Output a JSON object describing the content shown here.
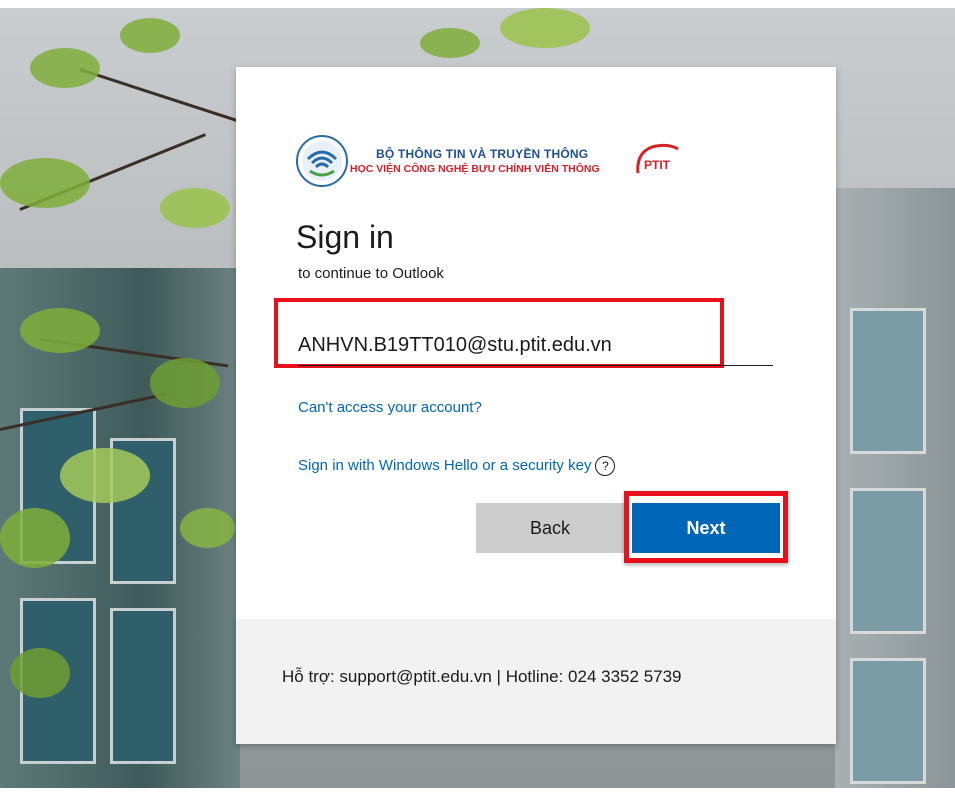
{
  "logo": {
    "org_line1": "BỘ THÔNG TIN VÀ TRUYỀN THÔNG",
    "org_line2": "HỌC VIỆN CÔNG NGHỆ BƯU CHÍNH VIỄN THÔNG",
    "mark": "PTIT"
  },
  "signin": {
    "title": "Sign in",
    "subtitle": "to continue to Outlook",
    "email_value": "ANHVN.B19TT010@stu.ptit.edu.vn",
    "cant_access_link": "Can't access your account?",
    "windows_hello_link": "Sign in with Windows Hello or a security key",
    "help_icon": "?",
    "back_label": "Back",
    "next_label": "Next"
  },
  "footer": {
    "text": "Hỗ trợ: support@ptit.edu.vn | Hotline: 024 3352 5739"
  },
  "colors": {
    "accent": "#0067b8",
    "highlight": "#e8111b"
  }
}
